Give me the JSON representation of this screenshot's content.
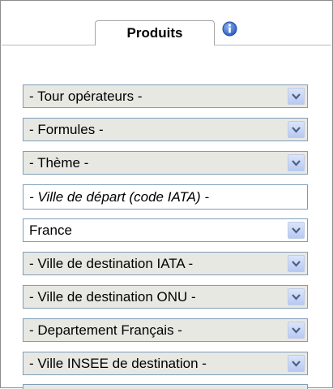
{
  "tab": {
    "label": "Produits"
  },
  "info_icon": {
    "glyph": "i",
    "color": "#3a6fd0"
  },
  "fields": {
    "tour_operateurs": "- Tour opérateurs -",
    "formules": "- Formules -",
    "theme": "- Thème -",
    "ville_depart_placeholder": "- Ville de départ (code IATA) -",
    "pays": "France",
    "ville_destination_iata": "- Ville de destination IATA -",
    "ville_destination_onu": "- Ville de destination ONU -",
    "departement_francais": "- Departement Français -",
    "ville_insee_destination": "- Ville INSEE de destination -"
  },
  "colors": {
    "dropdown_bg": "#e8e8e3",
    "border": "#7f9db9",
    "arrow_button": "#c9d7f5",
    "arrow_glyph": "#4d6185"
  }
}
